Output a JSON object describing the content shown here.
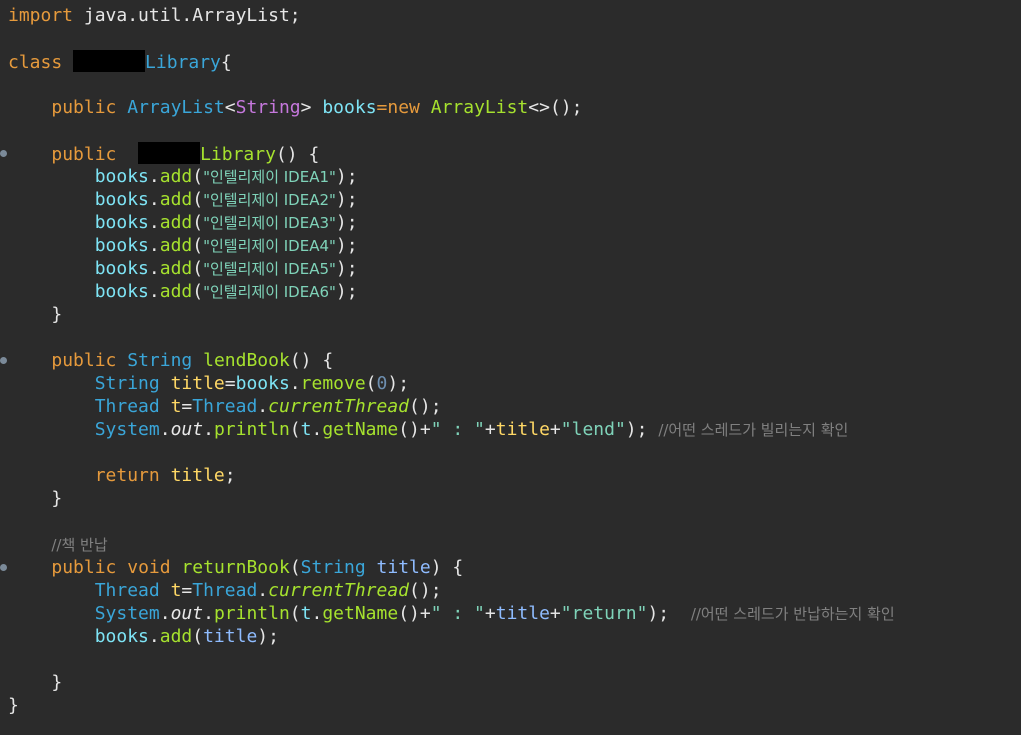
{
  "editor": {
    "lines": {
      "import_kw": "import",
      "import_pkg": "java.util.ArrayList;",
      "class_kw": "class",
      "class_name": "Library",
      "brace_open": "{",
      "public": "public",
      "arraylist": "ArrayList",
      "lt": "<",
      "string_type": "String",
      "gt": ">",
      "books": "books",
      "eq": "=",
      "new_kw": "new",
      "diamond_call": "<>();",
      "ctor_name": "Library",
      "ctor_parens": "() {",
      "add": "add",
      "book_titles": [
        "\"인텔리제이 IDEA1\"",
        "\"인텔리제이 IDEA2\"",
        "\"인텔리제이 IDEA3\"",
        "\"인텔리제이 IDEA4\"",
        "\"인텔리제이 IDEA5\"",
        "\"인텔리제이 IDEA6\""
      ],
      "brace_close": "}",
      "lend_method": "lendBook",
      "method_parens": "() {",
      "title": "title",
      "remove": "remove",
      "zero": "0",
      "thread_type": "Thread",
      "t": "t",
      "current_thread": "currentThread",
      "system": "System",
      "out": "out",
      "println": "println",
      "get_name": "getName",
      "colon_str": "\" : \"",
      "lend_str": "\"lend\"",
      "lend_comment": "//어떤 스레드가 빌리는지 확인",
      "return_kw": "return",
      "return_comment_line": "//책 반납",
      "void_kw": "void",
      "return_method": "returnBook",
      "return_str": "\"return\"",
      "return_comment": "//어떤 스레드가 반납하는지 확인"
    }
  }
}
